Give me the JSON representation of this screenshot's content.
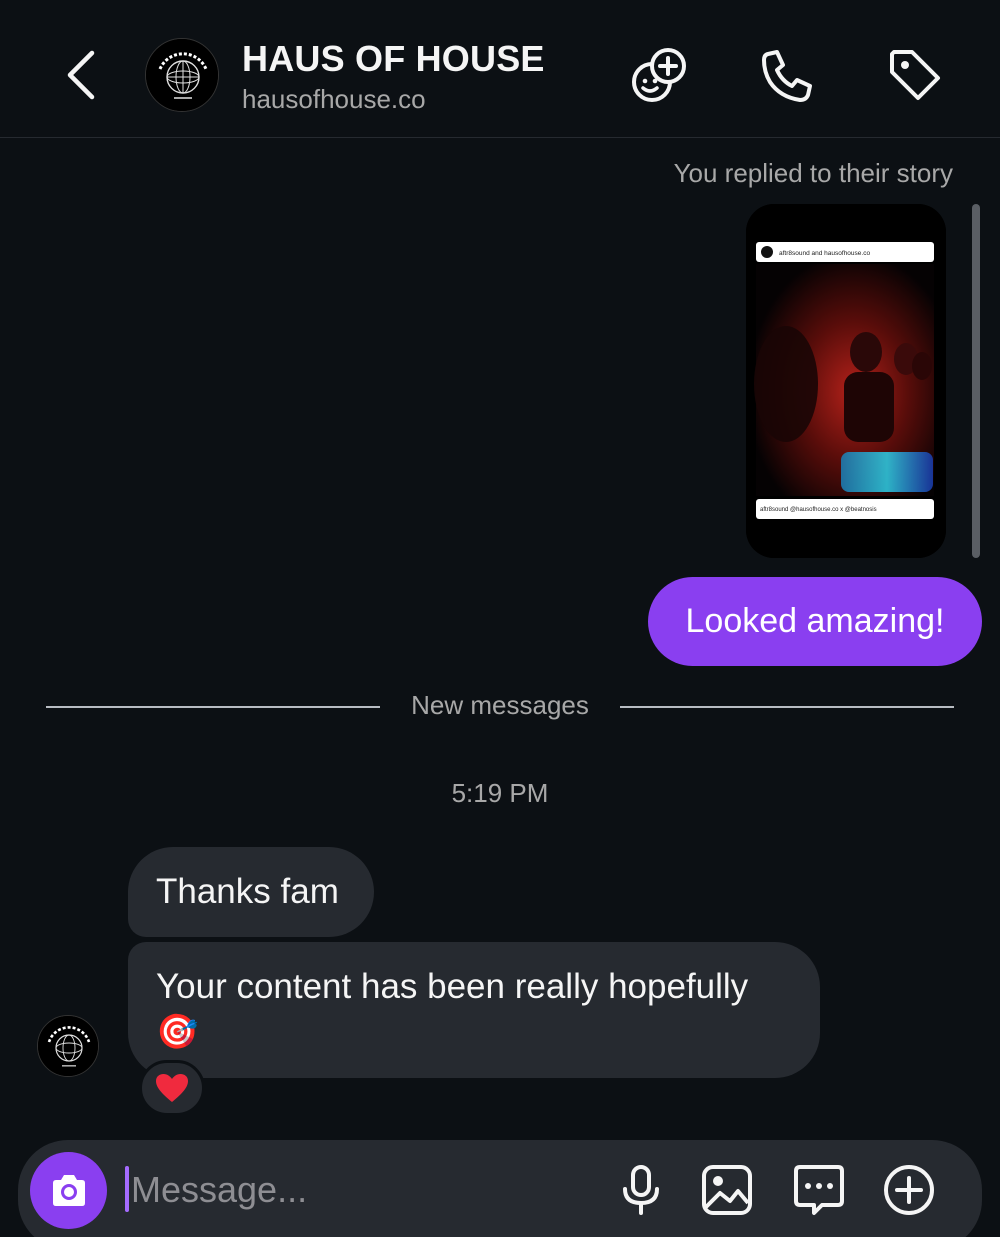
{
  "header": {
    "title": "HAUS OF HOUSE",
    "subtitle": "hausofhouse.co",
    "icons": [
      "back-chevron-icon",
      "add-games-icon",
      "phone-icon",
      "tag-icon"
    ]
  },
  "story_reply": {
    "note": "You replied to their story",
    "story_header": "aftr8sound and hausofhouse.co",
    "story_caption": "aftr8sound @hausofhouse.co x @beatnosis"
  },
  "outgoing": {
    "text": "Looked amazing!"
  },
  "divider": {
    "label": "New messages"
  },
  "timestamp": "5:19 PM",
  "incoming": [
    {
      "text": "Thanks fam"
    },
    {
      "text": "Your content has been really hopefully",
      "emoji": "🎯"
    }
  ],
  "reaction": {
    "emoji": "❤️"
  },
  "composer": {
    "placeholder": "Message...",
    "icons": [
      "camera-icon",
      "microphone-icon",
      "gallery-icon",
      "sticker-icon",
      "plus-icon"
    ]
  },
  "colors": {
    "background": "#0c1014",
    "accent": "#8a3ff0",
    "incoming_bubble": "#262a30",
    "secondary_text": "#a8a8a8"
  }
}
